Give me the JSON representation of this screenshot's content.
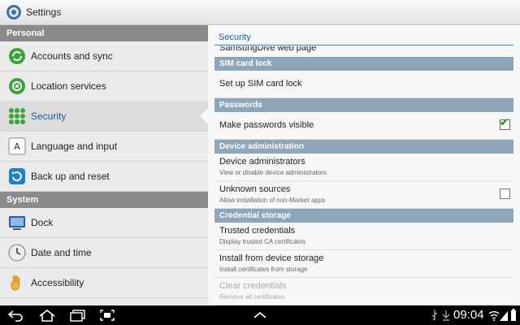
{
  "topbar": {
    "title": "Settings",
    "icon": "settings-gear-icon"
  },
  "left": {
    "personal_header": "Personal",
    "system_header": "System",
    "personal_items": [
      {
        "label": "Accounts and sync",
        "icon": "sync-icon"
      },
      {
        "label": "Location services",
        "icon": "location-icon"
      },
      {
        "label": "Security",
        "icon": "security-grid-icon",
        "selected": true
      },
      {
        "label": "Language and input",
        "icon": "keyboard-icon"
      },
      {
        "label": "Back up and reset",
        "icon": "backup-icon"
      }
    ],
    "system_items": [
      {
        "label": "Dock",
        "icon": "dock-icon"
      },
      {
        "label": "Date and time",
        "icon": "clock-icon"
      },
      {
        "label": "Accessibility",
        "icon": "hand-icon"
      }
    ]
  },
  "right": {
    "title": "Security",
    "cut_item": "SamsungDive web page",
    "sim_header": "SIM card lock",
    "sim_item": "Set up SIM card lock",
    "passwords_header": "Passwords",
    "make_visible": "Make passwords visible",
    "make_visible_checked": true,
    "device_admin_header": "Device administration",
    "device_admins": {
      "title": "Device administrators",
      "summary": "View or disable device administrators"
    },
    "unknown_sources": {
      "title": "Unknown sources",
      "summary": "Allow installation of non-Market apps",
      "checked": false
    },
    "credential_header": "Credential storage",
    "trusted": {
      "title": "Trusted credentials",
      "summary": "Display trusted CA certificates"
    },
    "install": {
      "title": "Install from device storage",
      "summary": "Install certificates from storage"
    },
    "clear": {
      "title": "Clear credentials",
      "summary": "Remove all certificates",
      "disabled": true
    }
  },
  "statusbar": {
    "time": "09:04"
  }
}
